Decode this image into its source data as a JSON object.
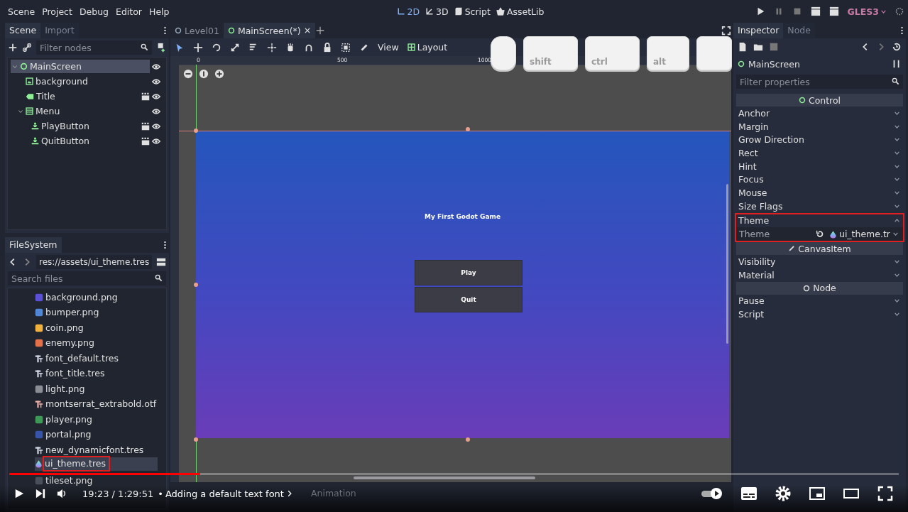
{
  "menu": [
    "Scene",
    "Project",
    "Debug",
    "Editor",
    "Help"
  ],
  "workspaces": [
    {
      "label": "2D",
      "kind": "flat",
      "selected": true
    },
    {
      "label": "3D",
      "kind": "spatial",
      "selected": false
    },
    {
      "label": "Script",
      "kind": "script",
      "selected": false
    },
    {
      "label": "AssetLib",
      "kind": "assetlib",
      "selected": false
    }
  ],
  "renderer": "GLES3",
  "scene_dock": {
    "tabs": [
      {
        "label": "Scene",
        "selected": true
      },
      {
        "label": "Import",
        "selected": false
      }
    ],
    "filter": {
      "placeholder": "Filter nodes"
    },
    "tree": [
      {
        "name": "MainScreen",
        "kind": "control",
        "selected": true,
        "instanced": false,
        "children": [
          {
            "name": "background",
            "kind": "texture",
            "selected": false,
            "instanced": false
          },
          {
            "name": "Title",
            "kind": "label",
            "selected": false,
            "instanced": true
          },
          {
            "name": "Menu",
            "kind": "vbox",
            "selected": false,
            "instanced": false,
            "children": [
              {
                "name": "PlayButton",
                "kind": "button",
                "selected": false,
                "instanced": true
              },
              {
                "name": "QuitButton",
                "kind": "button",
                "selected": false,
                "instanced": true
              }
            ]
          }
        ]
      }
    ]
  },
  "filesystem": {
    "title": "FileSystem",
    "path": "res://assets/ui_theme.tres",
    "search": {
      "placeholder": "Search files"
    },
    "files": [
      {
        "name": "background.png",
        "kind": "image",
        "color": "#5a4fd6",
        "selected": false
      },
      {
        "name": "bumper.png",
        "kind": "image",
        "color": "#4f86d8",
        "selected": false
      },
      {
        "name": "coin.png",
        "kind": "image",
        "color": "#f0b23c",
        "selected": false
      },
      {
        "name": "enemy.png",
        "kind": "image",
        "color": "#e4704a",
        "selected": false
      },
      {
        "name": "font_default.tres",
        "kind": "font",
        "selected": false
      },
      {
        "name": "font_title.tres",
        "kind": "font",
        "selected": false
      },
      {
        "name": "light.png",
        "kind": "image",
        "color": "#8a8d94",
        "selected": false
      },
      {
        "name": "montserrat_extrabold.otf",
        "kind": "fontfile",
        "selected": false
      },
      {
        "name": "player.png",
        "kind": "image",
        "color": "#3d9a56",
        "selected": false
      },
      {
        "name": "portal.png",
        "kind": "image",
        "color": "#3655a8",
        "selected": false
      },
      {
        "name": "new_dynamicfont.tres",
        "kind": "font",
        "selected": false
      },
      {
        "name": "ui_theme.tres",
        "kind": "theme",
        "selected": true
      },
      {
        "name": "tileset.png",
        "kind": "image",
        "color": "#4a4f5c",
        "selected": false
      }
    ]
  },
  "editor_tabs": [
    {
      "label": "Level01",
      "selected": false
    },
    {
      "label": "MainScreen(*)",
      "selected": true
    }
  ],
  "toolbar": {
    "view": "View",
    "layout": "Layout"
  },
  "ruler": [
    "0",
    "500",
    "1000"
  ],
  "keys": [
    {
      "kind": "mouse"
    },
    {
      "kind": "key",
      "label": "shift"
    },
    {
      "kind": "key",
      "label": "ctrl"
    },
    {
      "kind": "key",
      "label": "alt"
    },
    {
      "kind": "key"
    }
  ],
  "game": {
    "title": "My First Godot Game",
    "buttons": [
      "Play",
      "Quit"
    ]
  },
  "bottom_tabs": [
    "Animation"
  ],
  "inspector": {
    "tabs": [
      {
        "label": "Inspector",
        "selected": true
      },
      {
        "label": "Node",
        "selected": false
      }
    ],
    "object": "MainScreen",
    "filter": {
      "placeholder": "Filter properties"
    },
    "rows": [
      {
        "kind": "header",
        "label": "Control"
      },
      {
        "kind": "group",
        "label": "Anchor",
        "expanded": false
      },
      {
        "kind": "group",
        "label": "Margin",
        "expanded": false
      },
      {
        "kind": "group",
        "label": "Grow Direction",
        "expanded": false
      },
      {
        "kind": "group",
        "label": "Rect",
        "expanded": false
      },
      {
        "kind": "group",
        "label": "Hint",
        "expanded": false
      },
      {
        "kind": "group",
        "label": "Focus",
        "expanded": false
      },
      {
        "kind": "group",
        "label": "Mouse",
        "expanded": false
      },
      {
        "kind": "group",
        "label": "Size Flags",
        "expanded": false
      },
      {
        "kind": "group",
        "label": "Theme",
        "expanded": true,
        "children": [
          {
            "label": "Theme",
            "value": "ui_theme.tr"
          }
        ]
      },
      {
        "kind": "header",
        "label": "CanvasItem"
      },
      {
        "kind": "group",
        "label": "Visibility",
        "expanded": false
      },
      {
        "kind": "group",
        "label": "Material",
        "expanded": false
      },
      {
        "kind": "header",
        "label": "Node"
      },
      {
        "kind": "group",
        "label": "Pause",
        "expanded": false
      },
      {
        "kind": "group",
        "label": "Script",
        "expanded": false
      }
    ]
  },
  "video": {
    "progress": {
      "level": 0.215
    },
    "time": "19:23 / 1:29:51",
    "separator": "•",
    "chapter": "Adding a default text font",
    "autoplay": true
  }
}
